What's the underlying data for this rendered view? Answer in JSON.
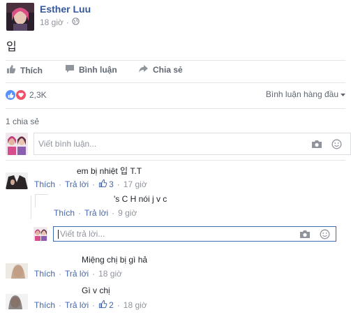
{
  "post": {
    "author": "Esther Luu",
    "time": "18 giờ",
    "body": "입"
  },
  "actions": {
    "like": "Thích",
    "comment": "Bình luận",
    "share": "Chia sẻ"
  },
  "reactions": {
    "count": "2,3K",
    "sort_label": "Bình luận hàng đầu"
  },
  "shares": {
    "label": "1 chia sẻ"
  },
  "composer": {
    "placeholder": "Viết bình luận..."
  },
  "comments": [
    {
      "text": "em bị nhiệt 입 T.T",
      "like": "Thích",
      "reply": "Trả lời",
      "likes": "3",
      "time": "17 giờ",
      "replies": [
        {
          "text": "'s C H nói j v c",
          "like": "Thích",
          "reply": "Trả lời",
          "time": "9 giờ"
        }
      ],
      "reply_placeholder": "Viết trả lời..."
    },
    {
      "text": "Miệng chị bị gì hả",
      "like": "Thích",
      "reply": "Trả lời",
      "time": "18 giờ"
    },
    {
      "text": "Gì v chị",
      "like": "Thích",
      "reply": "Trả lời",
      "likes": "2",
      "time": "18 giờ"
    }
  ],
  "colors": {
    "link": "#365899",
    "action": "#4267b2",
    "muted": "#90949c",
    "like_blue": "#5890ff",
    "love_red": "#f25268"
  }
}
